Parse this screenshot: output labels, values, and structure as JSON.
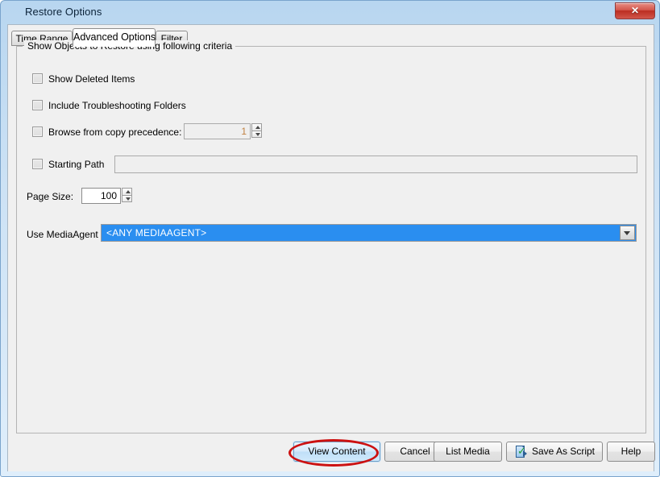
{
  "window": {
    "title": "Restore Options",
    "close_label": "✕"
  },
  "tabs": [
    {
      "label": "Time Range",
      "selected": false
    },
    {
      "label": "Advanced Options",
      "selected": true
    },
    {
      "label": "Filter",
      "selected": false
    }
  ],
  "groupbox": {
    "title": "Show Objects to Restore using following criteria"
  },
  "options": {
    "show_deleted_items": {
      "label": "Show Deleted Items",
      "checked": false
    },
    "include_troubleshooting_folders": {
      "label": "Include Troubleshooting Folders",
      "checked": false
    },
    "browse_from_copy_precedence": {
      "label": "Browse from copy precedence:",
      "checked": false,
      "value": "1"
    },
    "starting_path": {
      "label": "Starting Path",
      "checked": false,
      "value": "",
      "placeholder": ""
    },
    "page_size": {
      "label": "Page Size:",
      "value": "100"
    },
    "use_mediaagent": {
      "label": "Use MediaAgent",
      "selected_value": "<ANY MEDIAAGENT>",
      "options": [
        "<ANY MEDIAAGENT>"
      ]
    }
  },
  "buttons": {
    "view_content": "View Content",
    "cancel": "Cancel",
    "list_media": "List Media",
    "save_as_script": "Save As Script",
    "help": "Help"
  },
  "icons": {
    "close": "close-icon",
    "combo_arrow": "chevron-down-icon",
    "save_script": "script-document-check-icon",
    "spinner_up": "chevron-up-icon",
    "spinner_down": "chevron-down-icon"
  },
  "annotation": {
    "shape": "ellipse",
    "color": "#cc1111",
    "target": "View Content"
  },
  "colors": {
    "accent_selection": "#2a8ef0",
    "window_frame": "#b8d6f0",
    "client_background": "#f0f0f0",
    "annotation_red": "#cc1111",
    "close_button_red": "#bb2d21"
  }
}
